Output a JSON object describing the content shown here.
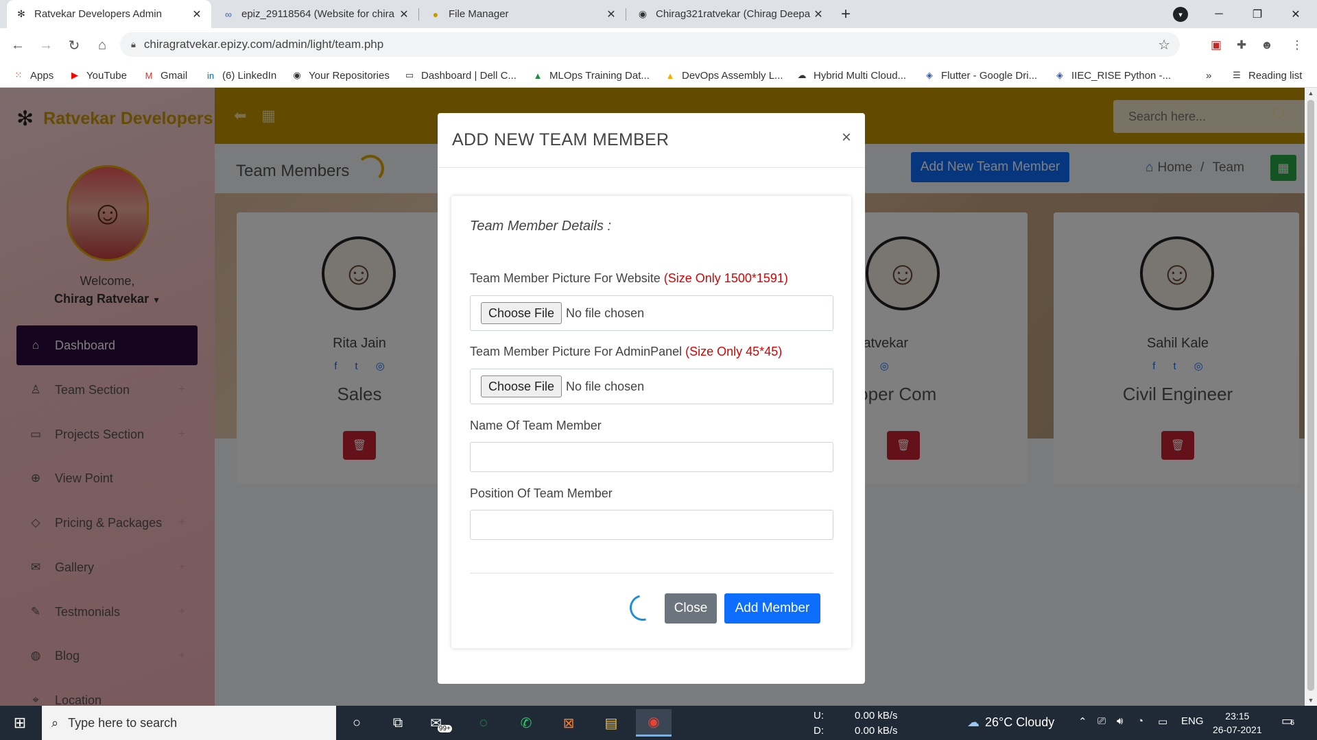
{
  "browser": {
    "tabs": [
      {
        "title": "Ratvekar Developers Admin",
        "icon": "team-logo-icon",
        "active": true
      },
      {
        "title": "epiz_29118564 (Website for chira",
        "icon": "infinity-icon",
        "active": false
      },
      {
        "title": "File Manager",
        "icon": "file-manager-icon",
        "active": false
      },
      {
        "title": "Chirag321ratvekar (Chirag Deepa",
        "icon": "github-icon",
        "active": false
      }
    ],
    "url": "chiragratvekar.epizy.com/admin/light/team.php",
    "bookmarks": [
      {
        "label": "Apps",
        "icon": "apps-grid-icon"
      },
      {
        "label": "YouTube",
        "icon": "youtube-icon"
      },
      {
        "label": "Gmail",
        "icon": "gmail-icon"
      },
      {
        "label": "(6) LinkedIn",
        "icon": "linkedin-icon"
      },
      {
        "label": "Your Repositories",
        "icon": "github-icon"
      },
      {
        "label": "Dashboard | Dell C...",
        "icon": "dell-icon"
      },
      {
        "label": "MLOps Training Dat...",
        "icon": "drive-icon"
      },
      {
        "label": "DevOps Assembly L...",
        "icon": "drive-icon"
      },
      {
        "label": "Hybrid Multi Cloud...",
        "icon": "cloud-icon"
      },
      {
        "label": "Flutter - Google Dri...",
        "icon": "flutter-icon"
      },
      {
        "label": "IIEC_RISE Python -...",
        "icon": "python-icon"
      }
    ],
    "more_bookmarks": "»",
    "reading_list": "Reading list"
  },
  "sidebar": {
    "brand": "Ratvekar Developers",
    "welcome": "Welcome,",
    "username": "Chirag Ratvekar",
    "items": [
      {
        "label": "Dashboard",
        "icon": "home-icon",
        "active": true
      },
      {
        "label": "Team Section",
        "icon": "user-icon"
      },
      {
        "label": "Projects Section",
        "icon": "monitor-icon"
      },
      {
        "label": "View Point",
        "icon": "crosshair-icon"
      },
      {
        "label": "Pricing & Packages",
        "icon": "diamond-icon"
      },
      {
        "label": "Gallery",
        "icon": "mail-icon"
      },
      {
        "label": "Testmonials",
        "icon": "pencil-icon"
      },
      {
        "label": "Blog",
        "icon": "globe-icon"
      },
      {
        "label": "Location",
        "icon": "location-icon"
      }
    ]
  },
  "topbar": {
    "search_placeholder": "Search here..."
  },
  "page": {
    "title": "Team Members",
    "add_button": "Add New Team Member",
    "breadcrumb_home": "Home",
    "breadcrumb_sep": "/",
    "breadcrumb_current": "Team"
  },
  "team_cards": [
    {
      "name": "Rita Jain",
      "position": "Sales"
    },
    {
      "name": "hirag Ratvekar",
      "position": "Developer Com"
    },
    {
      "name": "Sahil Kale",
      "position": "Civil Engineer"
    }
  ],
  "modal": {
    "title": "ADD NEW TEAM MEMBER",
    "close_symbol": "×",
    "section_title": "Team Member Details :",
    "field_website_pic": "Team Member Picture For Website",
    "field_website_pic_note": "(Size Only 1500*1591)",
    "field_admin_pic": "Team Member Picture For AdminPanel",
    "field_admin_pic_note": "(Size Only 45*45)",
    "choose_file": "Choose File",
    "no_file": "No file chosen",
    "field_name": "Name Of Team Member",
    "field_position": "Position Of Team Member",
    "close_button": "Close",
    "submit_button": "Add Member"
  },
  "taskbar": {
    "search_placeholder": "Type here to search",
    "badge": "99+",
    "net_up_label": "U:",
    "net_up_value": "0.00 kB/s",
    "net_down_label": "D:",
    "net_down_value": "0.00 kB/s",
    "weather": "26°C  Cloudy",
    "language": "ENG",
    "time": "23:15",
    "date": "26-07-2021",
    "notification_count": "6"
  }
}
